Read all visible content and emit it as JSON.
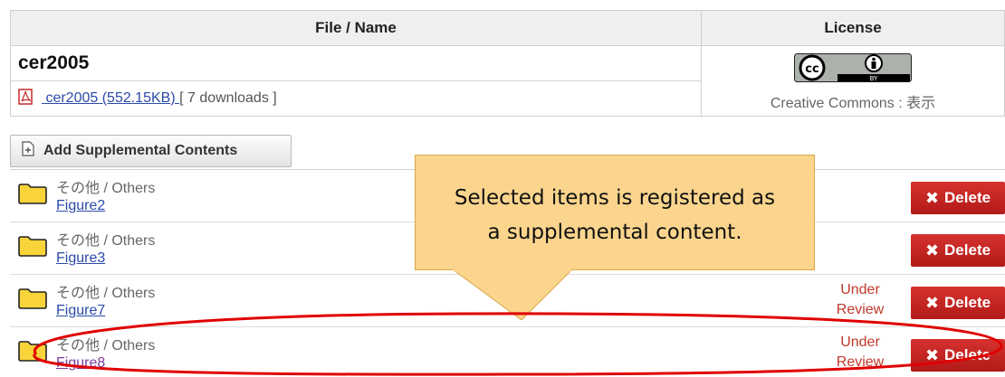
{
  "table": {
    "header_name": "File / Name",
    "header_license": "License",
    "title": "cer2005",
    "file": {
      "link_text": "  cer2005  (552.15KB) ",
      "downloads": "[ 7 downloads ]"
    },
    "license": {
      "badge_icon": "cc-by-icon",
      "text": "Creative Commons : 表示"
    }
  },
  "add_button": {
    "label": "Add Supplemental Contents",
    "icon": "plus-document-icon"
  },
  "supplements": [
    {
      "category": "その他 / Others",
      "name": "Figure2",
      "status": "",
      "delete_label": "Delete"
    },
    {
      "category": "その他 / Others",
      "name": "Figure3",
      "status": "",
      "delete_label": "Delete"
    },
    {
      "category": "その他 / Others",
      "name": "Figure7",
      "status": "Under Review",
      "delete_label": "Delete"
    },
    {
      "category": "その他 / Others",
      "name": "Figure8",
      "status": "Under Review",
      "delete_label": "Delete"
    }
  ],
  "callout": {
    "line1": "Selected items is registered as",
    "line2": "a supplemental content."
  },
  "colors": {
    "delete": "#c0201e",
    "link": "#2b4aa8",
    "status": "#c0392b",
    "callout": "#fbd58d",
    "highlight": "#e00000"
  }
}
